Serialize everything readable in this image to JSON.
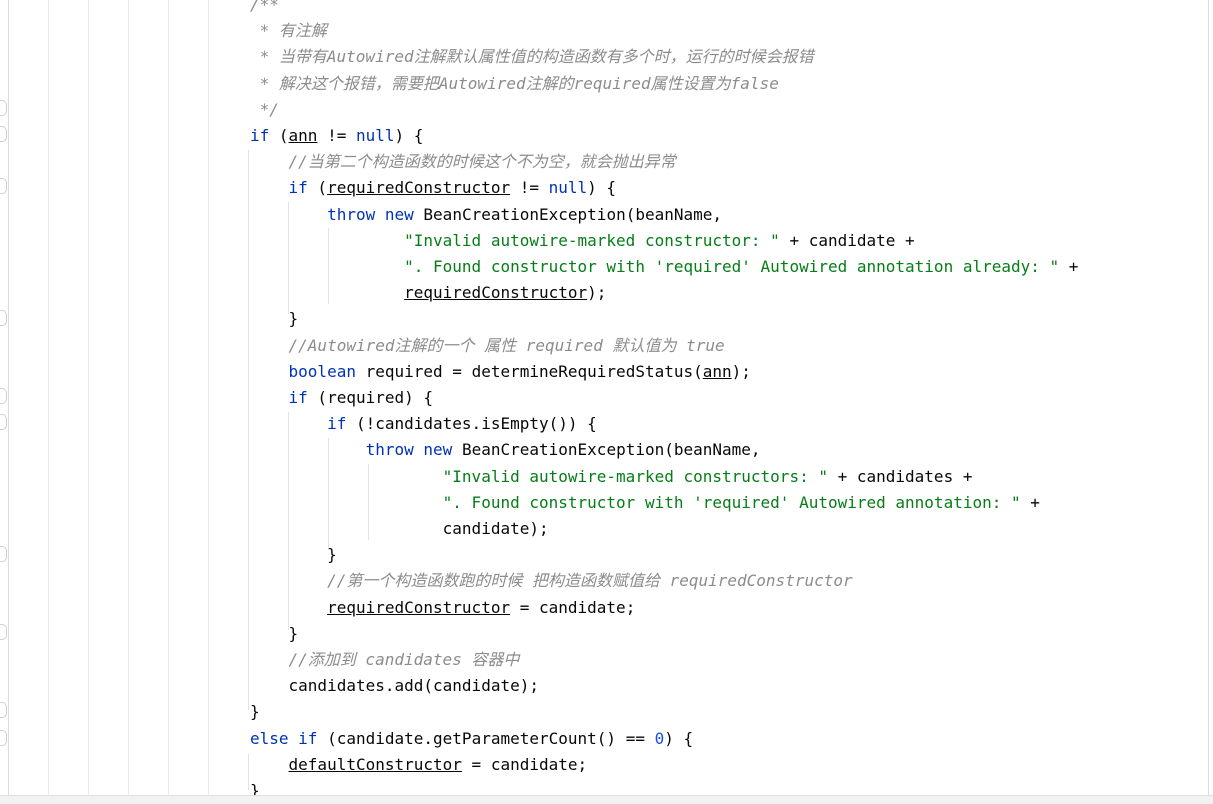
{
  "editor": {
    "lines": [
      [
        {
          "t": "/**",
          "c": "cm"
        }
      ],
      [
        {
          "t": " * 有注解",
          "c": "cm"
        }
      ],
      [
        {
          "t": " * 当带有Autowired注解默认属性值的构造函数有多个时，运行的时候会报错",
          "c": "cm"
        }
      ],
      [
        {
          "t": " * 解决这个报错，需要把Autowired注解的required属性设置为false",
          "c": "cm"
        }
      ],
      [
        {
          "t": " */",
          "c": "cm"
        }
      ],
      [
        {
          "t": "if",
          "c": "kw"
        },
        {
          "t": " ("
        },
        {
          "t": "ann",
          "c": "ul"
        },
        {
          "t": " != "
        },
        {
          "t": "null",
          "c": "kw"
        },
        {
          "t": ") {"
        }
      ],
      [
        {
          "t": "    "
        },
        {
          "t": "//当第二个构造函数的时候这个不为空，就会抛出异常",
          "c": "cm"
        }
      ],
      [
        {
          "t": "    "
        },
        {
          "t": "if",
          "c": "kw"
        },
        {
          "t": " ("
        },
        {
          "t": "requiredConstructor",
          "c": "ul"
        },
        {
          "t": " != "
        },
        {
          "t": "null",
          "c": "kw"
        },
        {
          "t": ") {"
        }
      ],
      [
        {
          "t": "        "
        },
        {
          "t": "throw",
          "c": "kw"
        },
        {
          "t": " "
        },
        {
          "t": "new",
          "c": "kw"
        },
        {
          "t": " BeanCreationException(beanName,"
        }
      ],
      [
        {
          "t": "                "
        },
        {
          "t": "\"Invalid autowire-marked constructor: \"",
          "c": "str"
        },
        {
          "t": " + candidate +"
        }
      ],
      [
        {
          "t": "                "
        },
        {
          "t": "\". Found constructor with 'required' Autowired annotation already: \"",
          "c": "str"
        },
        {
          "t": " +"
        }
      ],
      [
        {
          "t": "                "
        },
        {
          "t": "requiredConstructor",
          "c": "ul"
        },
        {
          "t": ");"
        }
      ],
      [
        {
          "t": "    }"
        }
      ],
      [
        {
          "t": "    "
        },
        {
          "t": "//Autowired注解的一个 属性 required 默认值为 true",
          "c": "cm"
        }
      ],
      [
        {
          "t": "    "
        },
        {
          "t": "boolean",
          "c": "kw"
        },
        {
          "t": " required = determineRequiredStatus("
        },
        {
          "t": "ann",
          "c": "ul"
        },
        {
          "t": ");"
        }
      ],
      [
        {
          "t": "    "
        },
        {
          "t": "if",
          "c": "kw"
        },
        {
          "t": " (required) {"
        }
      ],
      [
        {
          "t": "        "
        },
        {
          "t": "if",
          "c": "kw"
        },
        {
          "t": " (!candidates.isEmpty()) {"
        }
      ],
      [
        {
          "t": "            "
        },
        {
          "t": "throw",
          "c": "kw"
        },
        {
          "t": " "
        },
        {
          "t": "new",
          "c": "kw"
        },
        {
          "t": " BeanCreationException(beanName,"
        }
      ],
      [
        {
          "t": "                    "
        },
        {
          "t": "\"Invalid autowire-marked constructors: \"",
          "c": "str"
        },
        {
          "t": " + candidates +"
        }
      ],
      [
        {
          "t": "                    "
        },
        {
          "t": "\". Found constructor with 'required' Autowired annotation: \"",
          "c": "str"
        },
        {
          "t": " +"
        }
      ],
      [
        {
          "t": "                    candidate);"
        }
      ],
      [
        {
          "t": "        }"
        }
      ],
      [
        {
          "t": "        "
        },
        {
          "t": "//第一个构造函数跑的时候 把构造函数赋值给 requiredConstructor",
          "c": "cm"
        }
      ],
      [
        {
          "t": "        "
        },
        {
          "t": "requiredConstructor",
          "c": "ul"
        },
        {
          "t": " = candidate;"
        }
      ],
      [
        {
          "t": "    }"
        }
      ],
      [
        {
          "t": "    "
        },
        {
          "t": "//添加到 candidates 容器中",
          "c": "cm"
        }
      ],
      [
        {
          "t": "    candidates.add(candidate);"
        }
      ],
      [
        {
          "t": "}"
        }
      ],
      [
        {
          "t": "else if",
          "c": "kw"
        },
        {
          "t": " (candidate.getParameterCount() == "
        },
        {
          "t": "0",
          "c": "num"
        },
        {
          "t": ") {"
        }
      ],
      [
        {
          "t": "    "
        },
        {
          "t": "defaultConstructor",
          "c": "ul"
        },
        {
          "t": " = candidate;"
        }
      ],
      [
        {
          "t": "}"
        }
      ]
    ]
  }
}
